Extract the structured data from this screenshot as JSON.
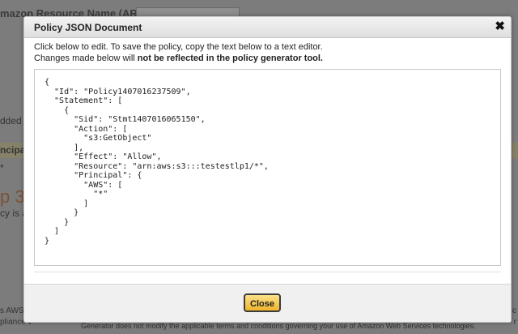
{
  "background": {
    "arn_label": "mazon Resource Name (ARN)",
    "added_text": "dded t",
    "principal_text": "ncipal",
    "star_text": "*",
    "step_text": "p 3:",
    "policy_is_text": "cy is a",
    "right_c": "c",
    "right_r": "r",
    "aws_left": "s AWS",
    "pliance_text": "pliance v",
    "footer_text": "Generator does not modify the applicable terms and conditions governing your use of Amazon Web Services technologies."
  },
  "dialog": {
    "title": "Policy JSON Document",
    "close_glyph": "✖",
    "instruction_line1": "Click below to edit. To save the policy, copy the text below to a text editor.",
    "instruction_line2_prefix": "Changes made below will ",
    "instruction_line2_bold": "not be reflected in the policy generator tool.",
    "policy_json": "{\n  \"Id\": \"Policy1407016237509\",\n  \"Statement\": [\n    {\n      \"Sid\": \"Stmt1407016065150\",\n      \"Action\": [\n        \"s3:GetObject\"\n      ],\n      \"Effect\": \"Allow\",\n      \"Resource\": \"arn:aws:s3:::testestlp1/*\",\n      \"Principal\": {\n        \"AWS\": [\n          \"*\"\n        ]\n      }\n    }\n  ]\n}",
    "close_button_label": "Close"
  },
  "colors": {
    "overlay": "#7c7c7c",
    "button_accent": "#f0b429",
    "step_heading": "#7a5236"
  }
}
